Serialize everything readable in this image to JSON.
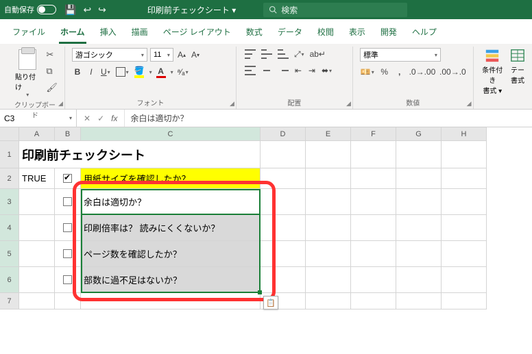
{
  "titlebar": {
    "autosave_label": "自動保存",
    "autosave_state": "オフ",
    "doc_title": "印刷前チェックシート ▾",
    "search_placeholder": "検索"
  },
  "tabs": [
    "ファイル",
    "ホーム",
    "挿入",
    "描画",
    "ページ レイアウト",
    "数式",
    "データ",
    "校閲",
    "表示",
    "開発",
    "ヘルプ"
  ],
  "active_tab": "ホーム",
  "ribbon": {
    "clipboard": {
      "paste": "貼り付け",
      "label": "クリップボード"
    },
    "font": {
      "name": "游ゴシック",
      "size": "11",
      "label": "フォント"
    },
    "align": {
      "label": "配置"
    },
    "number": {
      "format": "標準",
      "label": "数値"
    },
    "styles": {
      "cond": "条件付き\n書式 ▾",
      "table": "テー\n書式",
      "label": ""
    }
  },
  "namebox": "C3",
  "formula": "余白は適切か？",
  "columns": [
    "A",
    "B",
    "C",
    "D",
    "E",
    "F",
    "G",
    "H"
  ],
  "rows": {
    "1": {
      "title": "印刷前チェックシート"
    },
    "2": {
      "A": "TRUE",
      "checked": true,
      "C": "用紙サイズを確認したか？"
    },
    "3": {
      "checked": false,
      "C": "余白は適切か？"
    },
    "4": {
      "checked": false,
      "C": "印刷倍率は？ 読みにくくないか？"
    },
    "5": {
      "checked": false,
      "C": "ページ数を確認したか？"
    },
    "6": {
      "checked": false,
      "C": "部数に過不足はないか？"
    }
  }
}
